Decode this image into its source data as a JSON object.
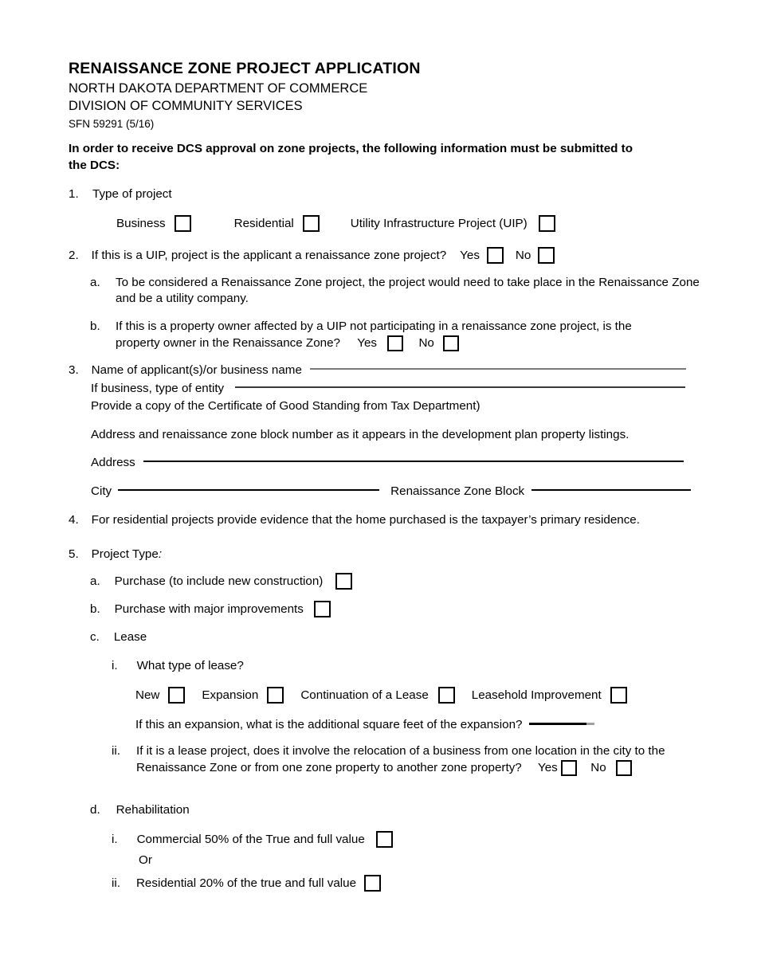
{
  "document": {
    "title": "RENAISSANCE ZONE PROJECT APPLICATION",
    "agency": "NORTH DAKOTA DEPARTMENT OF COMMERCE",
    "division": "DIVISION OF COMMUNITY SERVICES",
    "form_number": "SFN 59291 (5/16)",
    "intro": "In order to receive DCS approval on zone projects, the following information must be submitted to the DCS:"
  },
  "items": {
    "q1": {
      "number": "1.",
      "text": "Type of project",
      "options": [
        {
          "label": "Business",
          "checked": false
        },
        {
          "label": "Residential",
          "checked": false
        },
        {
          "label": "Utility Infrastructure Project (UIP)",
          "checked": false
        }
      ]
    },
    "q2": {
      "number": "2.",
      "text": "If this is a UIP, project is the applicant a renaissance zone project?",
      "yes_label": "Yes",
      "no_label": "No",
      "yes_checked": false,
      "no_checked": false,
      "sub_a": {
        "marker": "a.",
        "text": "To be considered a Renaissance Zone project, the project would need to take place in the Renaissance Zone and be a utility company."
      },
      "sub_b": {
        "marker": "b.",
        "text_line1": "If this is a property owner affected by a UIP not participating in a renaissance zone project, is the",
        "text_line2": "property owner in the Renaissance Zone?",
        "yes_label": "Yes",
        "no_label": "No",
        "yes_checked": false,
        "no_checked": false
      }
    },
    "q3": {
      "number": "3.",
      "name_label": "Name of applicant(s)/or business name",
      "name_value": "",
      "name_placeholder": "",
      "entity_label": "If business, type of entity",
      "entity_value": "",
      "entity_placeholder": "",
      "certificate_note": "Provide a copy of the Certificate of Good Standing from Tax Department)",
      "address_note": "Address and renaissance zone block number as it appears in the development plan property listings.",
      "address_label": "Address",
      "address_value": "",
      "city_label": "City",
      "city_value": "",
      "block_label": "Renaissance Zone Block",
      "block_value": ""
    },
    "q4": {
      "number": "4.",
      "text": "For residential projects provide evidence that the home purchased is the taxpayer’s primary residence."
    },
    "q5": {
      "number": "5.",
      "text": "Project Type",
      "colon": ":",
      "sub_a": {
        "marker": "a.",
        "text": "Purchase (to include new construction)",
        "checked": false
      },
      "sub_b": {
        "marker": "b.",
        "text": "Purchase with major improvements",
        "checked": false
      },
      "sub_c": {
        "marker": "c.",
        "text": "Lease",
        "roman_i": {
          "marker": "i.",
          "question": "What type of lease?",
          "options": [
            {
              "label": "New",
              "checked": false
            },
            {
              "label": "Expansion",
              "checked": false
            },
            {
              "label": "Continuation of a Lease",
              "checked": false
            },
            {
              "label": "Leasehold Improvement",
              "checked": false
            }
          ],
          "expansion_question": "If this an expansion, what is the additional square feet of the expansion?",
          "expansion_value": ""
        },
        "roman_ii": {
          "marker": "ii.",
          "text_line1": "If it is a lease project, does it involve the relocation of a business from one location in the city to the",
          "text_line2": "Renaissance Zone or from one zone property to another zone property?",
          "yes_label": "Yes",
          "no_label": "No",
          "yes_checked": false,
          "no_checked": false
        }
      },
      "sub_d": {
        "marker": "d.",
        "text": "Rehabilitation",
        "roman_i": {
          "marker": "i.",
          "text": "Commercial 50% of the True and full value",
          "checked": false
        },
        "or_label": "Or",
        "roman_ii": {
          "marker": "ii.",
          "text": "Residential 20% of the true and full value",
          "checked": false
        }
      }
    }
  }
}
